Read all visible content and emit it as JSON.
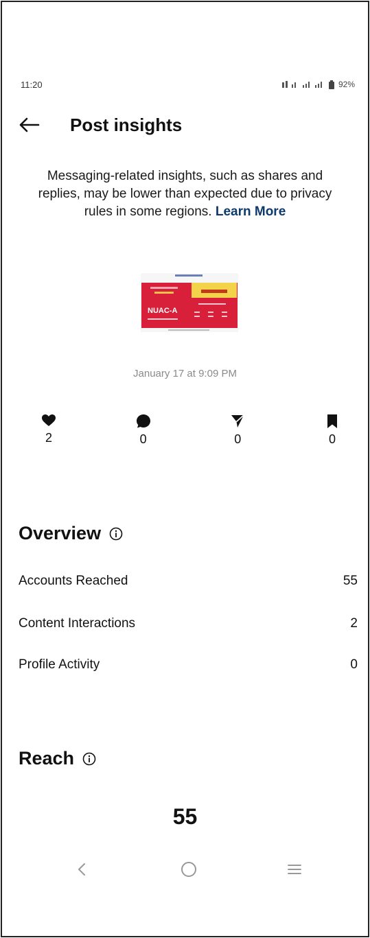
{
  "status_bar": {
    "time": "11:20",
    "battery": "92%"
  },
  "header": {
    "title": "Post insights"
  },
  "notice": {
    "text": "Messaging-related insights, such as shares and replies, may be lower than expected due to privacy rules in some regions. ",
    "link": "Learn More"
  },
  "post": {
    "date": "January 17 at 9:09 PM",
    "thumbnail_title": "NUAC-A"
  },
  "stats": [
    {
      "icon": "heart-icon",
      "value": "2"
    },
    {
      "icon": "comment-icon",
      "value": "0"
    },
    {
      "icon": "share-icon",
      "value": "0"
    },
    {
      "icon": "bookmark-icon",
      "value": "0"
    }
  ],
  "overview": {
    "title": "Overview",
    "rows": [
      {
        "label": "Accounts Reached",
        "value": "55"
      },
      {
        "label": "Content Interactions",
        "value": "2"
      },
      {
        "label": "Profile Activity",
        "value": "0"
      }
    ]
  },
  "reach": {
    "title": "Reach",
    "value": "55"
  },
  "colors": {
    "accent_link": "#0e3a6a",
    "thumbnail_red": "#d8203a",
    "thumbnail_yellow": "#f3d34a"
  }
}
